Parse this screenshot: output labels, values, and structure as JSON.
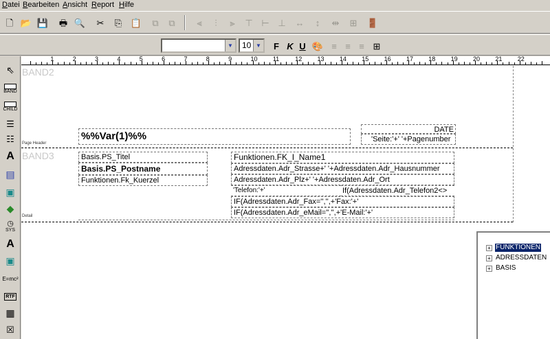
{
  "menu": [
    "Datei",
    "Bearbeiten",
    "Ansicht",
    "Report",
    "Hilfe"
  ],
  "toolbar1": {
    "buttons": [
      "new-document-icon",
      "open-folder-icon",
      "save-icon",
      "print-icon",
      "print-preview-icon",
      "cut-icon",
      "copy-icon",
      "paste-icon",
      "bring-to-front-icon",
      "send-to-back-icon",
      "align-left-edges-icon",
      "align-horizontal-centers-icon",
      "align-right-edges-icon",
      "align-top-edges-icon",
      "align-vertical-centers-icon",
      "align-bottom-edges-icon",
      "same-width-icon",
      "same-height-icon",
      "exit-door-icon"
    ]
  },
  "toolbar2": {
    "font_name": "",
    "font_size": "10",
    "bold_label": "F",
    "italic_label": "K",
    "underline_label": "U"
  },
  "palette": {
    "band_label": "BAND",
    "child_label": "CHILD",
    "text_label": "A",
    "sys_label": "SYS",
    "formula_label": "E=mc²",
    "rtf_label": "RTF"
  },
  "ruler": {
    "numbers": [
      "1",
      "2",
      "3",
      "4",
      "5",
      "6",
      "7",
      "8",
      "9",
      "10",
      "11",
      "12",
      "13",
      "14",
      "15",
      "16",
      "17",
      "18",
      "19",
      "20",
      "21",
      "22"
    ]
  },
  "bands": {
    "band2": {
      "title": "BAND2",
      "label": "Page Header",
      "fields": {
        "var": "%%Var(1)%%",
        "date": "DATE",
        "page": "'Seite:'+' '+Pagenumber"
      }
    },
    "band3": {
      "title": "BAND3",
      "label": "Detail",
      "fields": {
        "titel": "Basis.PS_Titel",
        "postname": "Basis.PS_Postname",
        "kuerzel": "Funktionen.Fk_Kuerzel",
        "name1": "Funktionen.FK_I_Name1",
        "strasse": "Adressdaten.Adr_Strasse+' '+Adressdaten.Adr_Hausnummer",
        "plz": "Adressdaten.Adr_Plz+' '+Adressdaten.Adr_Ort",
        "telefon_label": "'Telefon:'+'",
        "telefon_if": "If(Adressdaten.Adr_Telefon2<>",
        "fax": "IF(Adressdaten.Adr_Fax='','',+'Fax:'+'",
        "email": "IF(Adressdaten.Adr_eMail='','',+'E-Mail:'+'"
      }
    }
  },
  "tree": {
    "items": [
      "FUNKTIONEN",
      "ADRESSDATEN",
      "BASIS"
    ],
    "expand_glyph": "+"
  }
}
